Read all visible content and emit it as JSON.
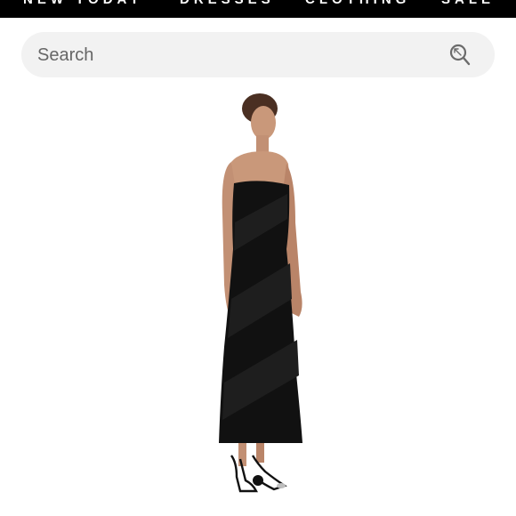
{
  "nav": {
    "items": [
      {
        "label": "NEW TODAY"
      },
      {
        "label": "DRESSES"
      },
      {
        "label": "CLOTHING"
      },
      {
        "label": "SALE"
      }
    ]
  },
  "search": {
    "placeholder": "Search",
    "icon": "search-icon"
  },
  "product": {
    "image_icon": "product-photo-strapless-black-velvet-maxi-dress",
    "dress_color": "#111111",
    "skin_color": "#c9987a",
    "hair_color": "#4a2f22"
  },
  "colors": {
    "nav_background": "#000000",
    "search_background": "#f2f2f2"
  }
}
